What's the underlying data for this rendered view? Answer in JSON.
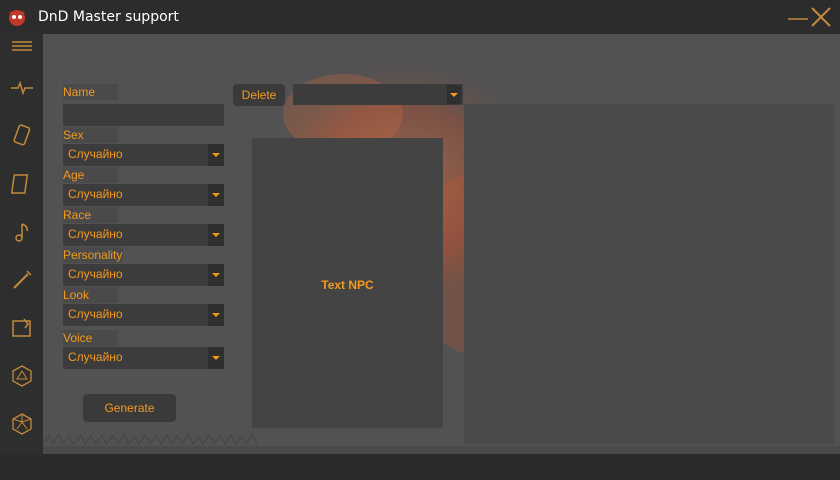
{
  "window": {
    "title": "DnD Master support"
  },
  "form": {
    "fields": [
      {
        "label": "Name",
        "value": ""
      },
      {
        "label": "Sex",
        "value": "Случайно"
      },
      {
        "label": "Age",
        "value": "Случайно"
      },
      {
        "label": "Race",
        "value": "Случайно"
      },
      {
        "label": "Personality",
        "value": "Случайно"
      },
      {
        "label": "Look",
        "value": "Случайно"
      },
      {
        "label": "Voice",
        "value": "Случайно"
      }
    ],
    "generate_label": "Generate"
  },
  "toolbar": {
    "delete_label": "Delete",
    "delete_select_value": ""
  },
  "npc": {
    "text": "Text NPC"
  },
  "colors": {
    "accent": "#f39a1e",
    "background": "#2b2b2b",
    "panel": "#525252"
  },
  "sidebar": {
    "items": [
      {
        "icon": "menu-icon"
      },
      {
        "icon": "pulse-icon"
      },
      {
        "icon": "card-icon"
      },
      {
        "icon": "scroll-icon"
      },
      {
        "icon": "music-note-icon"
      },
      {
        "icon": "wand-icon"
      },
      {
        "icon": "map-icon"
      },
      {
        "icon": "d20-icon"
      },
      {
        "icon": "d12-icon"
      }
    ]
  }
}
